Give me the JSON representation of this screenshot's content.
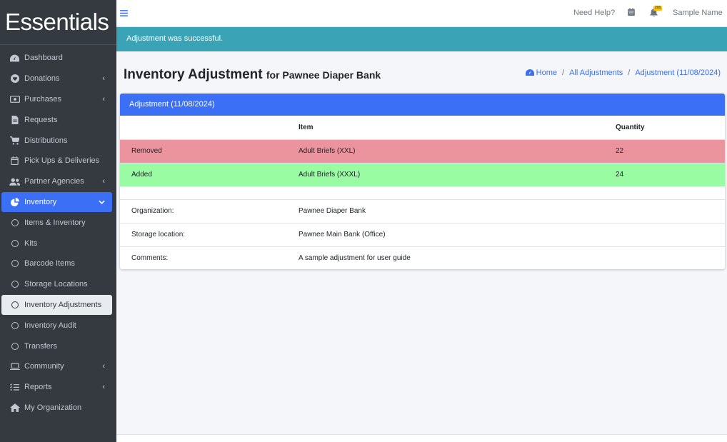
{
  "brand": "Essentials",
  "sidebar": {
    "items": [
      {
        "label": "Dashboard"
      },
      {
        "label": "Donations"
      },
      {
        "label": "Purchases"
      },
      {
        "label": "Requests"
      },
      {
        "label": "Distributions"
      },
      {
        "label": "Pick Ups & Deliveries"
      },
      {
        "label": "Partner Agencies"
      },
      {
        "label": "Inventory"
      },
      {
        "label": "Items & Inventory"
      },
      {
        "label": "Kits"
      },
      {
        "label": "Barcode Items"
      },
      {
        "label": "Storage Locations"
      },
      {
        "label": "Inventory Adjustments"
      },
      {
        "label": "Inventory Audit"
      },
      {
        "label": "Transfers"
      },
      {
        "label": "Community"
      },
      {
        "label": "Reports"
      },
      {
        "label": "My Organization"
      }
    ]
  },
  "topbar": {
    "help": "Need Help?",
    "notification_badge": "205",
    "user_name": "Sample Name"
  },
  "alert": {
    "message": "Adjustment was successful."
  },
  "header": {
    "title": "Inventory Adjustment",
    "subtitle": "for Pawnee Diaper Bank"
  },
  "breadcrumb": {
    "home": "Home",
    "all": "All Adjustments",
    "current": "Adjustment (11/08/2024)"
  },
  "card": {
    "title": "Adjustment (11/08/2024)",
    "columns": [
      "",
      "Item",
      "Quantity"
    ],
    "rows": [
      {
        "type": "Removed",
        "item": "Adult Briefs (XXL)",
        "quantity": "22"
      },
      {
        "type": "Added",
        "item": "Adult Briefs (XXXL)",
        "quantity": "24"
      }
    ],
    "info": [
      {
        "label": "Organization:",
        "value": "Pawnee Diaper Bank"
      },
      {
        "label": "Storage location:",
        "value": "Pawnee Main Bank (Office)"
      },
      {
        "label": "Comments:",
        "value": "A sample adjustment for user guide"
      }
    ]
  },
  "colors": {
    "primary": "#3b6ff5",
    "removed_row": "#eb949e",
    "added_row": "#99fca2",
    "alert": "#3aa3b6",
    "sidebar_bg": "#343a40"
  }
}
